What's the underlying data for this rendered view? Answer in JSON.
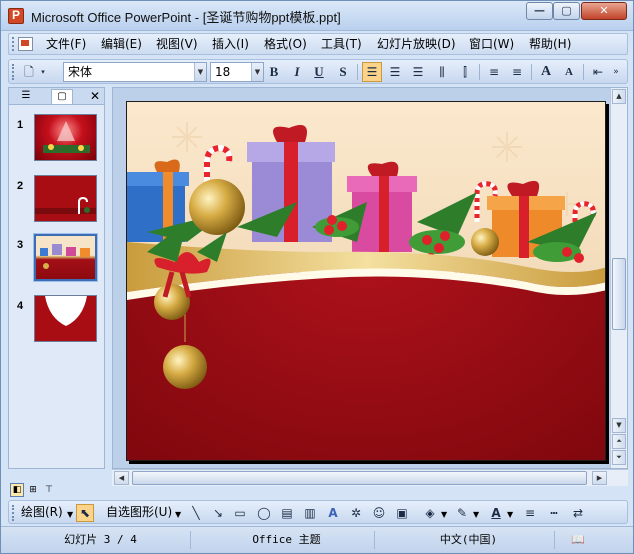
{
  "window": {
    "title": "Microsoft Office PowerPoint - [圣诞节购物ppt模板.ppt]",
    "minimize_glyph": "—",
    "maximize_glyph": "▢",
    "close_glyph": "✕"
  },
  "menu": {
    "items": [
      {
        "label": "文件(F)"
      },
      {
        "label": "编辑(E)"
      },
      {
        "label": "视图(V)"
      },
      {
        "label": "插入(I)"
      },
      {
        "label": "格式(O)"
      },
      {
        "label": "工具(T)"
      },
      {
        "label": "幻灯片放映(D)"
      },
      {
        "label": "窗口(W)"
      },
      {
        "label": "帮助(H)"
      }
    ]
  },
  "format_toolbar": {
    "font_name": "宋体",
    "font_size": "18",
    "bold": "B",
    "italic": "I",
    "underline": "U",
    "shadow": "S",
    "align_left_active": true,
    "grow_font": "A",
    "shrink_font": "A"
  },
  "outline_pane": {
    "close_glyph": "✕",
    "slides": [
      {
        "number": "1",
        "selected": false
      },
      {
        "number": "2",
        "selected": false
      },
      {
        "number": "3",
        "selected": true
      },
      {
        "number": "4",
        "selected": false
      }
    ]
  },
  "drawing_toolbar": {
    "draw_menu": "绘图(R)",
    "autoshapes_menu": "自选图形(U)"
  },
  "status_bar": {
    "slide_position": "幻灯片 3 / 4",
    "design": "Office 主题",
    "language": "中文(中国)"
  },
  "colors": {
    "slide_red": "#9d0c13",
    "slide_cream": "#f6e4c8",
    "gold": "#d8b04a",
    "selection_highlight": "#fbd38a"
  }
}
